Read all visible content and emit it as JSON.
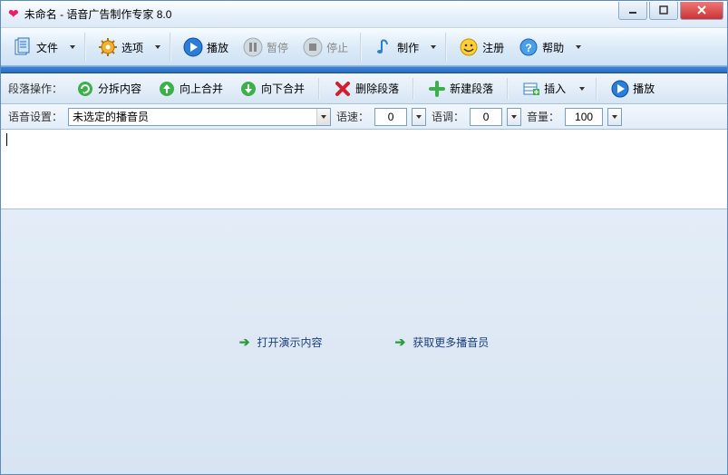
{
  "window": {
    "title": "未命名 - 语音广告制作专家 8.0"
  },
  "toolbar": {
    "file": "文件",
    "options": "选项",
    "play": "播放",
    "pause": "暂停",
    "stop": "停止",
    "make": "制作",
    "register": "注册",
    "help": "帮助"
  },
  "segment": {
    "label": "段落操作：",
    "split": "分拆内容",
    "merge_up": "向上合并",
    "merge_down": "向下合并",
    "delete": "删除段落",
    "new": "新建段落",
    "insert": "插入",
    "play": "播放"
  },
  "voice": {
    "label": "语音设置：",
    "announcer_value": "未选定的播音员",
    "speed_label": "语速：",
    "speed_value": "0",
    "pitch_label": "语调：",
    "pitch_value": "0",
    "volume_label": "音量：",
    "volume_value": "100"
  },
  "links": {
    "open_demo": "打开演示内容",
    "get_more": "获取更多播音员"
  }
}
